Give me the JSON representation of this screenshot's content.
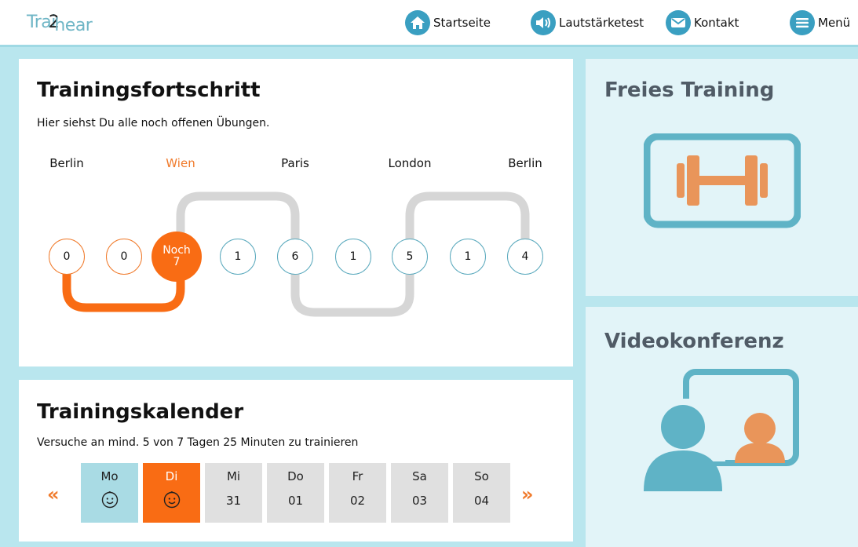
{
  "header": {
    "logo": {
      "part1": "Trai",
      "part2": "2",
      "part3": "hear"
    },
    "nav": [
      {
        "label": "Startseite",
        "icon": "home-icon"
      },
      {
        "label": "Lautstärketest",
        "icon": "speaker-icon"
      },
      {
        "label": "Kontakt",
        "icon": "mail-icon"
      },
      {
        "label": "Menü",
        "icon": "menu-icon"
      }
    ]
  },
  "progress": {
    "title": "Trainingsfortschritt",
    "subtitle": "Hier siehst Du alle noch offenen Übungen.",
    "cities": [
      "Berlin",
      "Wien",
      "Paris",
      "London",
      "Berlin"
    ],
    "nodes": [
      "0",
      "0",
      "Noch",
      "1",
      "6",
      "1",
      "5",
      "1",
      "4"
    ],
    "current_line2": "7"
  },
  "calendar": {
    "title": "Trainingskalender",
    "subtitle": "Versuche an mind. 5 von 7 Tagen 25 Minuten zu trainieren",
    "prev": "«",
    "next": "»",
    "days": [
      {
        "name": "Mo",
        "value": ""
      },
      {
        "name": "Di",
        "value": ""
      },
      {
        "name": "Mi",
        "value": "31"
      },
      {
        "name": "Do",
        "value": "01"
      },
      {
        "name": "Fr",
        "value": "02"
      },
      {
        "name": "Sa",
        "value": "03"
      },
      {
        "name": "So",
        "value": "04"
      }
    ]
  },
  "side": {
    "free_training": "Freies Training",
    "video_conference": "Videokonferenz"
  },
  "colors": {
    "orange": "#f96c14",
    "teal": "#5fb3c6",
    "gray": "#d9d9d9",
    "background": "#b9e6ee"
  }
}
